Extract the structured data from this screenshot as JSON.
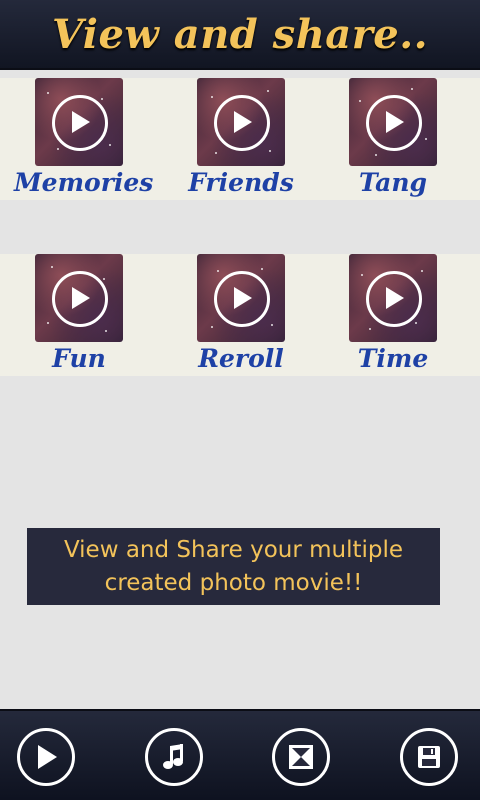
{
  "header": {
    "title": "View and share.."
  },
  "videos": [
    {
      "label": "Memories"
    },
    {
      "label": "Friends"
    },
    {
      "label": "Tang"
    },
    {
      "label": "Fun"
    },
    {
      "label": "Reroll"
    },
    {
      "label": "Time"
    }
  ],
  "info": {
    "line1": "View and Share your multiple",
    "line2": "created photo movie!!"
  },
  "bottom_nav": [
    {
      "icon": "play-icon"
    },
    {
      "icon": "music-note-icon"
    },
    {
      "icon": "hourglass-icon"
    },
    {
      "icon": "save-icon"
    }
  ],
  "colors": {
    "accent_gold": "#f3c35a",
    "label_blue": "#1e41a6",
    "bar_dark": "#24293b"
  }
}
